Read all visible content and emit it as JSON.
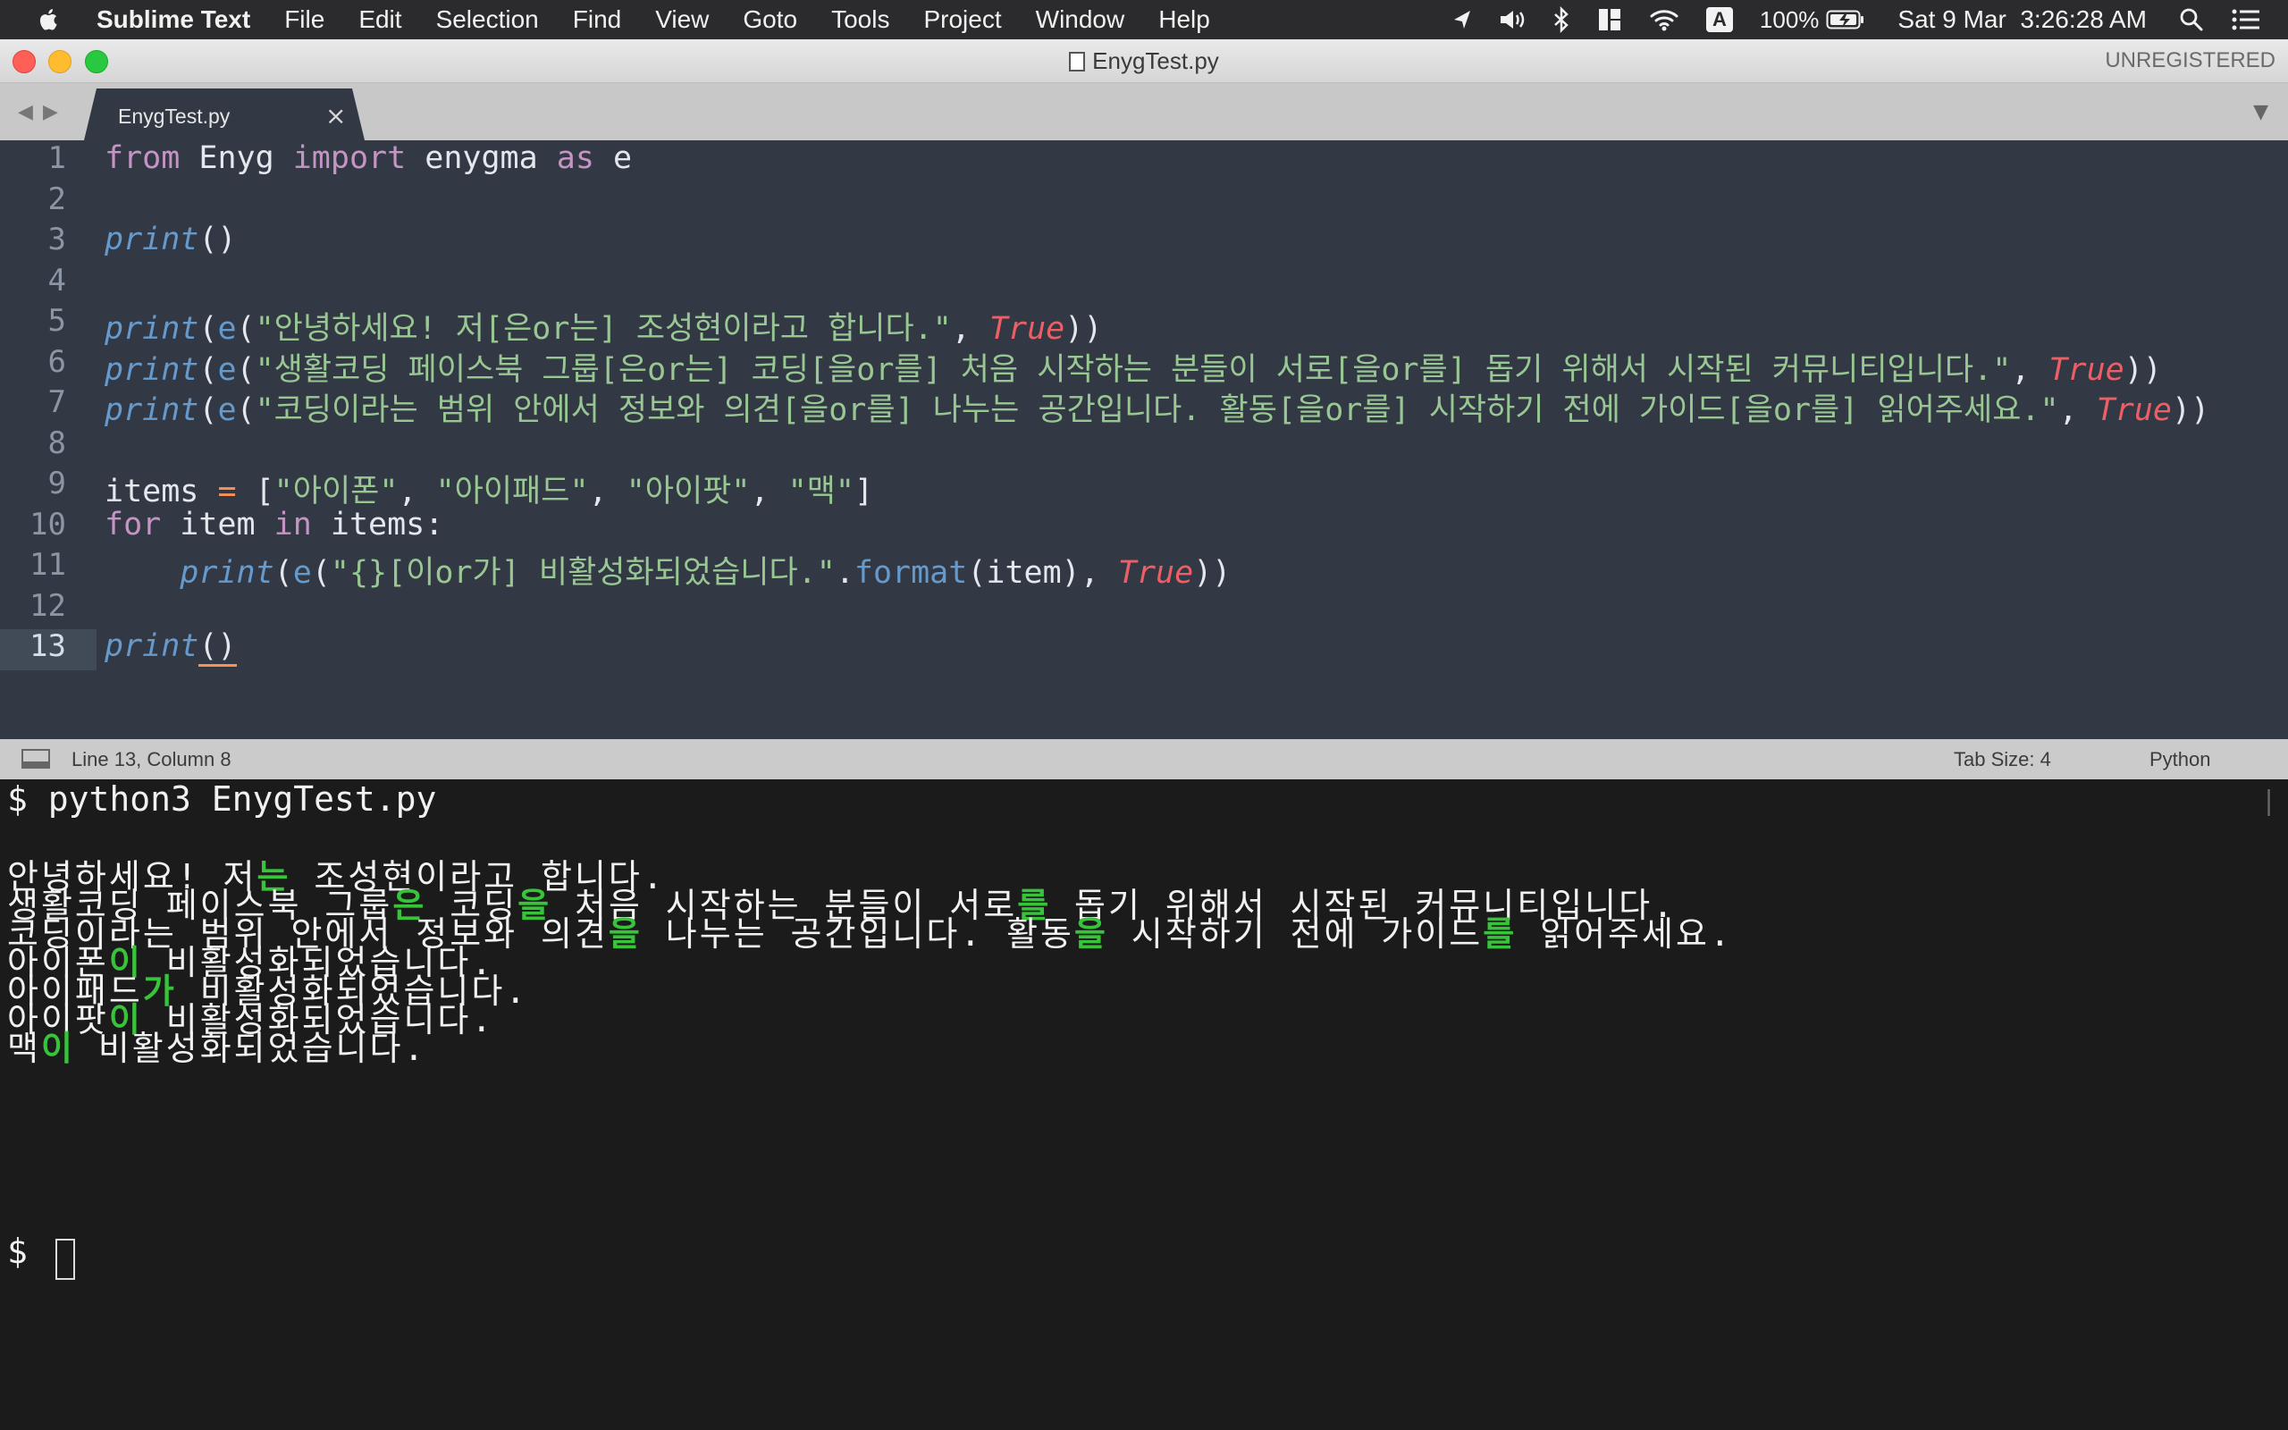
{
  "menubar": {
    "app_name": "Sublime Text",
    "menus": [
      "File",
      "Edit",
      "Selection",
      "Find",
      "View",
      "Goto",
      "Tools",
      "Project",
      "Window",
      "Help"
    ],
    "input_source": "A",
    "battery": "100%",
    "datetime": "Sat 9 Mar  3:26:28 AM"
  },
  "window": {
    "title": "EnygTest.py",
    "license": "UNREGISTERED"
  },
  "tab": {
    "label": "EnygTest.py",
    "close": "×"
  },
  "editor": {
    "line_numbers": [
      "1",
      "2",
      "3",
      "4",
      "5",
      "6",
      "7",
      "8",
      "9",
      "10",
      "11",
      "12",
      "13"
    ],
    "current_line": 13,
    "lines": [
      [
        {
          "t": "from",
          "c": "kw"
        },
        {
          "t": " Enyg ",
          "c": "var"
        },
        {
          "t": "import",
          "c": "kw"
        },
        {
          "t": " enygma ",
          "c": "var"
        },
        {
          "t": "as",
          "c": "kw"
        },
        {
          "t": " e",
          "c": "var"
        }
      ],
      [],
      [
        {
          "t": "print",
          "c": "fn"
        },
        {
          "t": "()",
          "c": "var"
        }
      ],
      [],
      [
        {
          "t": "print",
          "c": "fn"
        },
        {
          "t": "(",
          "c": "var"
        },
        {
          "t": "e",
          "c": "call"
        },
        {
          "t": "(",
          "c": "var"
        },
        {
          "t": "\"안녕하세요! 저[은or는] 조성현이라고 합니다.\"",
          "c": "str"
        },
        {
          "t": ", ",
          "c": "var"
        },
        {
          "t": "True",
          "c": "bool"
        },
        {
          "t": "))",
          "c": "var"
        }
      ],
      [
        {
          "t": "print",
          "c": "fn"
        },
        {
          "t": "(",
          "c": "var"
        },
        {
          "t": "e",
          "c": "call"
        },
        {
          "t": "(",
          "c": "var"
        },
        {
          "t": "\"생활코딩 페이스북 그룹[은or는] 코딩[을or를] 처음 시작하는 분들이 서로[을or를] 돕기 위해서 시작된 커뮤니티입니다.\"",
          "c": "str"
        },
        {
          "t": ", ",
          "c": "var"
        },
        {
          "t": "True",
          "c": "bool"
        },
        {
          "t": "))",
          "c": "var"
        }
      ],
      [
        {
          "t": "print",
          "c": "fn"
        },
        {
          "t": "(",
          "c": "var"
        },
        {
          "t": "e",
          "c": "call"
        },
        {
          "t": "(",
          "c": "var"
        },
        {
          "t": "\"코딩이라는 범위 안에서 정보와 의견[을or를] 나누는 공간입니다. 활동[을or를] 시작하기 전에 가이드[을or를] 읽어주세요.\"",
          "c": "str"
        },
        {
          "t": ", ",
          "c": "var"
        },
        {
          "t": "True",
          "c": "bool"
        },
        {
          "t": "))",
          "c": "var"
        }
      ],
      [],
      [
        {
          "t": "items ",
          "c": "var"
        },
        {
          "t": "=",
          "c": "op"
        },
        {
          "t": " [",
          "c": "var"
        },
        {
          "t": "\"아이폰\"",
          "c": "str"
        },
        {
          "t": ", ",
          "c": "var"
        },
        {
          "t": "\"아이패드\"",
          "c": "str"
        },
        {
          "t": ", ",
          "c": "var"
        },
        {
          "t": "\"아이팟\"",
          "c": "str"
        },
        {
          "t": ", ",
          "c": "var"
        },
        {
          "t": "\"맥\"",
          "c": "str"
        },
        {
          "t": "]",
          "c": "var"
        }
      ],
      [
        {
          "t": "for",
          "c": "kw"
        },
        {
          "t": " item ",
          "c": "var"
        },
        {
          "t": "in",
          "c": "kw"
        },
        {
          "t": " items:",
          "c": "var"
        }
      ],
      [
        {
          "t": "    ",
          "c": "var"
        },
        {
          "t": "print",
          "c": "fn"
        },
        {
          "t": "(",
          "c": "var"
        },
        {
          "t": "e",
          "c": "call"
        },
        {
          "t": "(",
          "c": "var"
        },
        {
          "t": "\"{}[이or가] 비활성화되었습니다.\"",
          "c": "str"
        },
        {
          "t": ".",
          "c": "var"
        },
        {
          "t": "format",
          "c": "call"
        },
        {
          "t": "(item), ",
          "c": "var"
        },
        {
          "t": "True",
          "c": "bool"
        },
        {
          "t": "))",
          "c": "var"
        }
      ],
      [],
      [
        {
          "t": "print",
          "c": "fn"
        },
        {
          "t": "()",
          "c": "bracket-hi"
        }
      ]
    ]
  },
  "statusbar": {
    "position": "Line 13, Column 8",
    "tab_size": "Tab Size: 4",
    "syntax": "Python"
  },
  "terminal": {
    "command": "$ python3 EnygTest.py",
    "output": [
      [
        {
          "t": "안녕하세요! 저"
        },
        {
          "t": "는",
          "hl": true
        },
        {
          "t": " 조성현이라고 합니다."
        }
      ],
      [
        {
          "t": "생활코딩 페이스북 그룹"
        },
        {
          "t": "은",
          "hl": true
        },
        {
          "t": " 코딩"
        },
        {
          "t": "을",
          "hl": true
        },
        {
          "t": " 처음 시작하는 분들이 서로"
        },
        {
          "t": "를",
          "hl": true
        },
        {
          "t": " 돕기 위해서 시작된 커뮤니티입니다."
        }
      ],
      [
        {
          "t": "코딩이라는 범위 안에서 정보와 의견"
        },
        {
          "t": "을",
          "hl": true
        },
        {
          "t": " 나누는 공간입니다. 활동"
        },
        {
          "t": "을",
          "hl": true
        },
        {
          "t": " 시작하기 전에 가이드"
        },
        {
          "t": "를",
          "hl": true
        },
        {
          "t": " 읽어주세요."
        }
      ],
      [
        {
          "t": "아이폰"
        },
        {
          "t": "이",
          "hl": true
        },
        {
          "t": " 비활성화되었습니다."
        }
      ],
      [
        {
          "t": "아이패드"
        },
        {
          "t": "가",
          "hl": true
        },
        {
          "t": " 비활성화되었습니다."
        }
      ],
      [
        {
          "t": "아이팟"
        },
        {
          "t": "이",
          "hl": true
        },
        {
          "t": " 비활성화되었습니다."
        }
      ],
      [
        {
          "t": "맥"
        },
        {
          "t": "이",
          "hl": true
        },
        {
          "t": " 비활성화되었습니다."
        }
      ]
    ],
    "prompt": "$"
  },
  "colors": {
    "editor_bg": "#323944",
    "terminal_bg": "#1b1b1b",
    "highlight_green": "#37c43b"
  },
  "icons": [
    "apple-icon",
    "location-icon",
    "volume-icon",
    "bluetooth-icon",
    "window-manager-icon",
    "wifi-icon",
    "battery-icon",
    "spotlight-icon",
    "notification-center-icon"
  ]
}
